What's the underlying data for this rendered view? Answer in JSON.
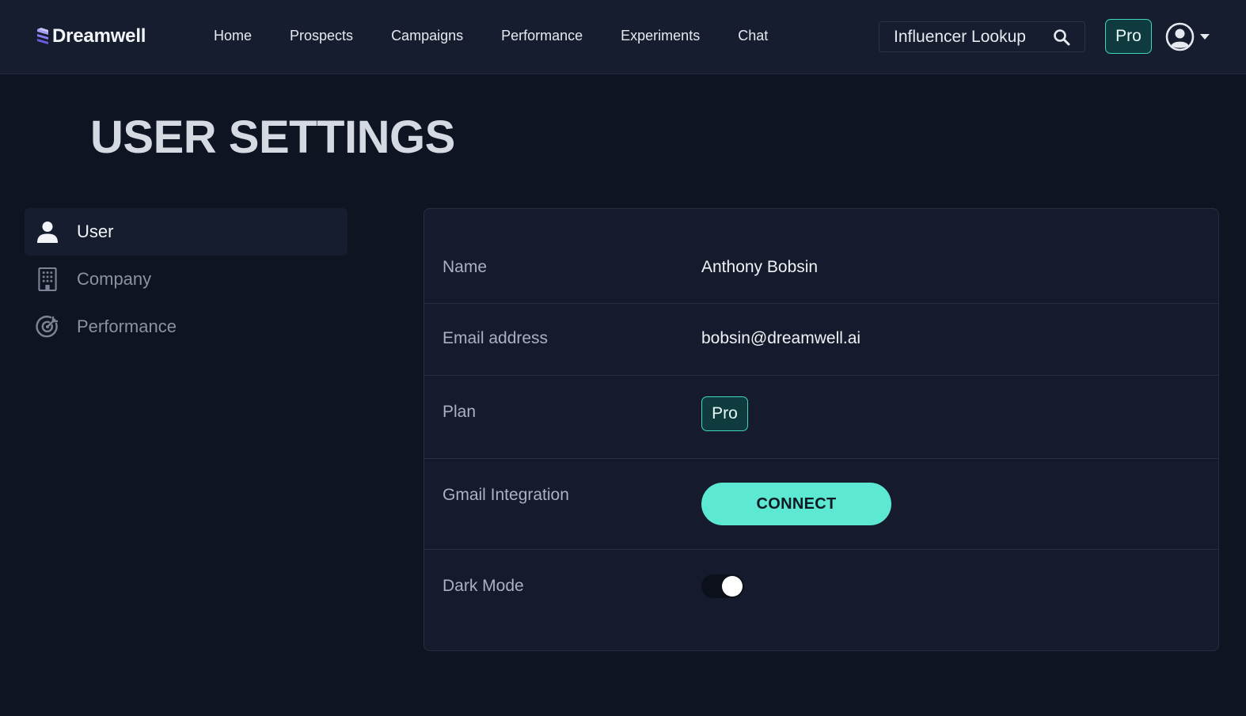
{
  "app": {
    "brand": "Dreamwell",
    "accent_color": "#5de8d4",
    "logo_color": "#8b7cf6"
  },
  "nav": {
    "links": [
      "Home",
      "Prospects",
      "Campaigns",
      "Performance",
      "Experiments",
      "Chat"
    ],
    "search_label": "Influencer Lookup",
    "search_icon": "search-icon",
    "plan_chip": "Pro",
    "account_icon": "user-circle-icon"
  },
  "page": {
    "title": "USER SETTINGS"
  },
  "sidebar": {
    "items": [
      {
        "label": "User",
        "icon": "person-icon",
        "active": true
      },
      {
        "label": "Company",
        "icon": "building-icon",
        "active": false
      },
      {
        "label": "Performance",
        "icon": "target-icon",
        "active": false
      }
    ]
  },
  "settings": {
    "name_label": "Name",
    "name_value": "Anthony Bobsin",
    "email_label": "Email address",
    "email_value": "bobsin@dreamwell.ai",
    "plan_label": "Plan",
    "plan_value": "Pro",
    "gmail_label": "Gmail Integration",
    "gmail_button": "CONNECT",
    "dark_mode_label": "Dark Mode",
    "dark_mode_on": true
  }
}
